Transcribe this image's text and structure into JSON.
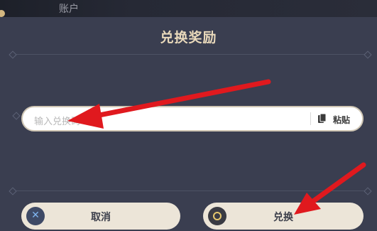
{
  "header": {
    "account_label": "账户"
  },
  "dialog": {
    "title": "兑换奖励",
    "code_input": {
      "placeholder": "输入兑换码",
      "value": ""
    },
    "paste_label": "粘贴",
    "cancel_label": "取消",
    "redeem_label": "兑换"
  },
  "colors": {
    "annotation_arrow": "#e0191e",
    "button_bg": "#ece5d8",
    "title_text": "#e9d9bb",
    "panel_bg": "#3a3e50"
  },
  "icons": [
    "cancel-x-icon",
    "paste-clipboard-icon",
    "confirm-circle-icon"
  ]
}
